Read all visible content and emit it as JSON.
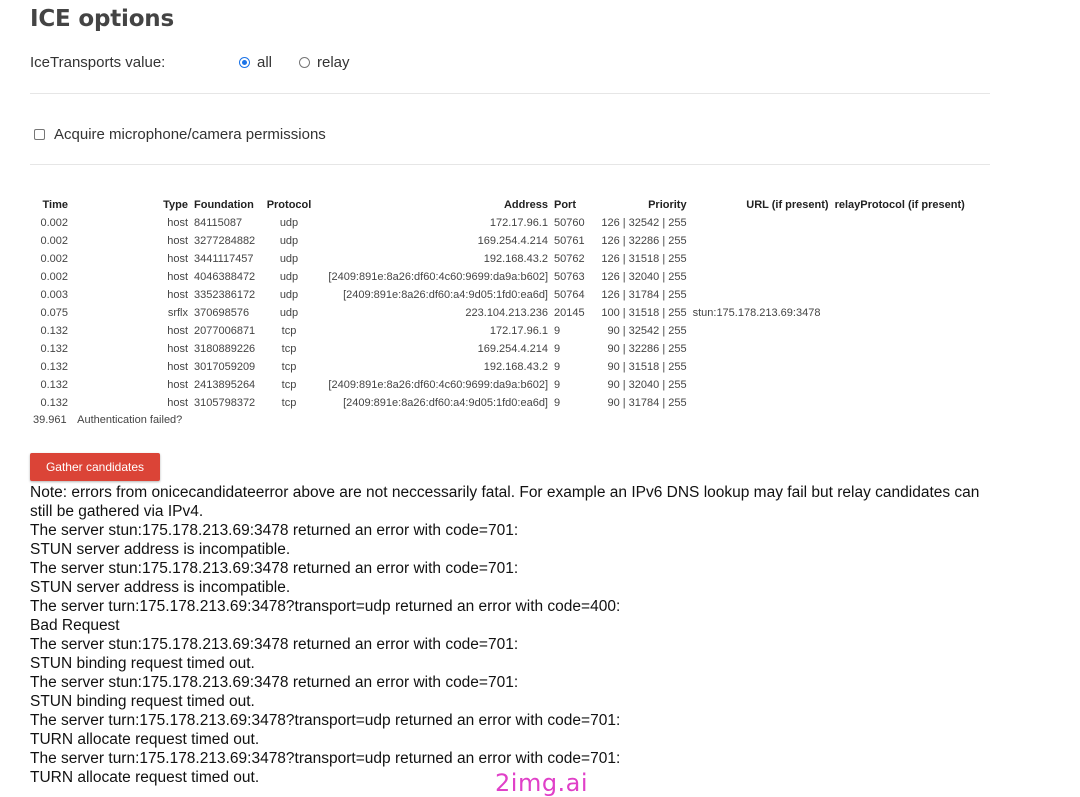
{
  "heading": "ICE options",
  "ice": {
    "label": "IceTransports value:",
    "options": [
      {
        "label": "all",
        "checked": true
      },
      {
        "label": "relay",
        "checked": false
      }
    ]
  },
  "permissions": {
    "label": "Acquire microphone/camera permissions",
    "checked": false
  },
  "table": {
    "headers": {
      "time": "Time",
      "type": "Type",
      "foundation": "Foundation",
      "protocol": "Protocol",
      "address": "Address",
      "port": "Port",
      "priority": "Priority",
      "url": "URL (if present)",
      "relay": "relayProtocol (if present)"
    },
    "rows": [
      {
        "time": "0.002",
        "type": "host",
        "foundation": "84115087",
        "protocol": "udp",
        "address": "172.17.96.1",
        "port": "50760",
        "priority": "126 | 32542 | 255",
        "url": ""
      },
      {
        "time": "0.002",
        "type": "host",
        "foundation": "3277284882",
        "protocol": "udp",
        "address": "169.254.4.214",
        "port": "50761",
        "priority": "126 | 32286 | 255",
        "url": ""
      },
      {
        "time": "0.002",
        "type": "host",
        "foundation": "3441117457",
        "protocol": "udp",
        "address": "192.168.43.2",
        "port": "50762",
        "priority": "126 | 31518 | 255",
        "url": ""
      },
      {
        "time": "0.002",
        "type": "host",
        "foundation": "4046388472",
        "protocol": "udp",
        "address": "[2409:891e:8a26:df60:4c60:9699:da9a:b602]",
        "port": "50763",
        "priority": "126 | 32040 | 255",
        "url": ""
      },
      {
        "time": "0.003",
        "type": "host",
        "foundation": "3352386172",
        "protocol": "udp",
        "address": "[2409:891e:8a26:df60:a4:9d05:1fd0:ea6d]",
        "port": "50764",
        "priority": "126 | 31784 | 255",
        "url": ""
      },
      {
        "time": "0.075",
        "type": "srflx",
        "foundation": "370698576",
        "protocol": "udp",
        "address": "223.104.213.236",
        "port": "20145",
        "priority": "100 | 31518 | 255",
        "url": "stun:175.178.213.69:3478"
      },
      {
        "time": "0.132",
        "type": "host",
        "foundation": "2077006871",
        "protocol": "tcp",
        "address": "172.17.96.1",
        "port": "9",
        "priority": "90 | 32542 | 255",
        "url": ""
      },
      {
        "time": "0.132",
        "type": "host",
        "foundation": "3180889226",
        "protocol": "tcp",
        "address": "169.254.4.214",
        "port": "9",
        "priority": "90 | 32286 | 255",
        "url": ""
      },
      {
        "time": "0.132",
        "type": "host",
        "foundation": "3017059209",
        "protocol": "tcp",
        "address": "192.168.43.2",
        "port": "9",
        "priority": "90 | 31518 | 255",
        "url": ""
      },
      {
        "time": "0.132",
        "type": "host",
        "foundation": "2413895264",
        "protocol": "tcp",
        "address": "[2409:891e:8a26:df60:4c60:9699:da9a:b602]",
        "port": "9",
        "priority": "90 | 32040 | 255",
        "url": ""
      },
      {
        "time": "0.132",
        "type": "host",
        "foundation": "3105798372",
        "protocol": "tcp",
        "address": "[2409:891e:8a26:df60:a4:9d05:1fd0:ea6d]",
        "port": "9",
        "priority": "90 | 31784 | 255",
        "url": ""
      }
    ],
    "final": {
      "time": "39.961",
      "message": "Authentication failed?"
    }
  },
  "button": {
    "label": "Gather candidates"
  },
  "notes": [
    "Note: errors from onicecandidateerror above are not neccessarily fatal. For example an IPv6 DNS lookup may fail but relay candidates can still be gathered via IPv4.",
    "The server stun:175.178.213.69:3478 returned an error with code=701:",
    "STUN server address is incompatible.",
    "The server stun:175.178.213.69:3478 returned an error with code=701:",
    "STUN server address is incompatible.",
    "The server turn:175.178.213.69:3478?transport=udp returned an error with code=400:",
    "Bad Request",
    "The server stun:175.178.213.69:3478 returned an error with code=701:",
    "STUN binding request timed out.",
    "The server stun:175.178.213.69:3478 returned an error with code=701:",
    "STUN binding request timed out.",
    "The server turn:175.178.213.69:3478?transport=udp returned an error with code=701:",
    "TURN allocate request timed out.",
    "The server turn:175.178.213.69:3478?transport=udp returned an error with code=701:",
    "TURN allocate request timed out."
  ],
  "watermark": "2img.ai",
  "colors": {
    "button": "#db4437",
    "radio_accent": "#1a73e8",
    "watermark": "#e040c8"
  }
}
